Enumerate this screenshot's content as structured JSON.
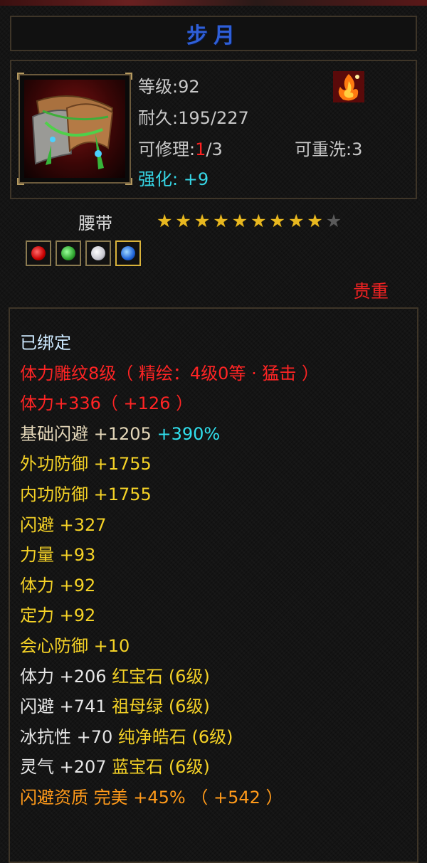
{
  "item": {
    "title": "步月",
    "level": "等级:92",
    "durability": "耐久:195/227",
    "repair_label": "可修理:",
    "repair_current": "1",
    "repair_max": "/3",
    "rewash": "可重洗:3",
    "enhance_label": "强化:",
    "enhance_value": " +9",
    "name": "腰带",
    "stars_filled": 9,
    "stars_total": 10,
    "gems": [
      "ruby-gem-icon",
      "emerald-gem-icon",
      "white-jade-gem-icon",
      "sapphire-gem-icon"
    ],
    "rarity": "贵重"
  },
  "attributes": [
    {
      "text": "已绑定",
      "style": "bound"
    },
    {
      "text": "体力雕纹8级（ 精绘：4级0等 · 猛击 ）",
      "style": "red2"
    },
    {
      "text": "体力+336（ +126 ）",
      "style": "red2"
    },
    {
      "parts": [
        {
          "text": "基础闪避 +1205 ",
          "style": "beige"
        },
        {
          "text": "+390%",
          "style": "cyan2"
        }
      ]
    },
    {
      "text": "外功防御 +1755",
      "style": "yel"
    },
    {
      "text": "内功防御 +1755",
      "style": "yel"
    },
    {
      "text": "闪避 +327",
      "style": "yel"
    },
    {
      "text": "力量 +93",
      "style": "yel"
    },
    {
      "text": "体力 +92",
      "style": "yel"
    },
    {
      "text": "定力 +92",
      "style": "yel"
    },
    {
      "text": "会心防御 +10",
      "style": "yel"
    },
    {
      "parts": [
        {
          "text": "体力 +206 ",
          "style": "white"
        },
        {
          "text": "红宝石 (6级)",
          "style": "yel"
        }
      ]
    },
    {
      "parts": [
        {
          "text": "闪避 +741 ",
          "style": "white"
        },
        {
          "text": "祖母绿 (6级)",
          "style": "yel"
        }
      ]
    },
    {
      "parts": [
        {
          "text": "冰抗性 +70 ",
          "style": "white"
        },
        {
          "text": "纯净皓石 (6级)",
          "style": "yel"
        }
      ]
    },
    {
      "parts": [
        {
          "text": "灵气 +207 ",
          "style": "white"
        },
        {
          "text": "蓝宝石 (6级)",
          "style": "yel"
        }
      ]
    },
    {
      "text": "闪避资质  完美 +45% （ +542 ）",
      "style": "orange"
    }
  ],
  "colors": {
    "title": "#2f5fd8",
    "star_gold": "#e8b820",
    "rarity_red": "#ee2222"
  }
}
